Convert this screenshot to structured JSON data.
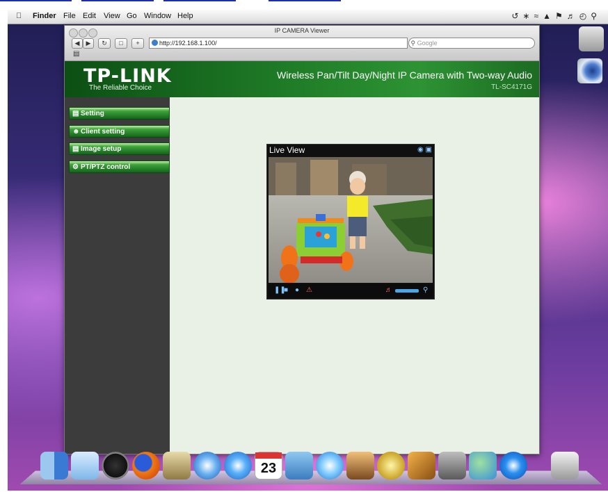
{
  "menubar": {
    "apple": "",
    "app_name": "Finder",
    "menus": [
      "File",
      "Edit",
      "View",
      "Go",
      "Window",
      "Help"
    ]
  },
  "browser": {
    "window_title": "IP CAMERA Viewer",
    "url": "http://192.168.1.100/",
    "search_placeholder": "Google"
  },
  "header": {
    "logo": "TP-LINK",
    "tagline": "The Reliable Choice",
    "product_title": "Wireless Pan/Tilt Day/Night IP Camera with Two-way Audio",
    "model": "TL-SC4171G"
  },
  "sidebar": {
    "items": [
      {
        "label": "Setting",
        "icon": "page-icon"
      },
      {
        "label": "Client setting",
        "icon": "users-icon"
      },
      {
        "label": "Image setup",
        "icon": "image-icon"
      },
      {
        "label": "PT/PTZ control",
        "icon": "ptz-icon"
      }
    ]
  },
  "viewer": {
    "title": "Live View"
  },
  "dock": {
    "icons": [
      "finder-icon",
      "dashboard-icon",
      "firefox-icon",
      "mail-icon",
      "safari-icon",
      "ichat-icon",
      "ical-icon",
      "iphoto-icon",
      "itunes-icon",
      "photo-icon",
      "star-icon",
      "garageband-icon",
      "system-prefs-icon",
      "contacts-icon",
      "quicktime-icon",
      "trash-icon"
    ],
    "ical_date": "23"
  }
}
